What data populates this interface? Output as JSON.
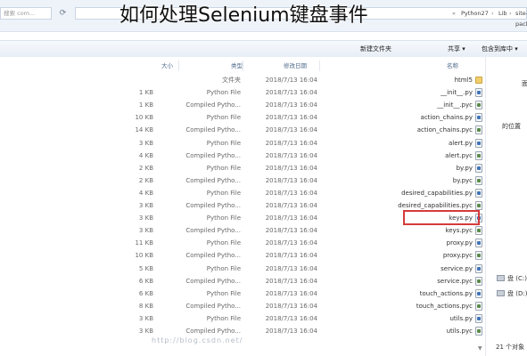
{
  "title": "如何处理Selenium键盘事件",
  "search": {
    "placeholder": "搜索 com..."
  },
  "breadcrumb": [
    "Python27",
    "Lib",
    "site-packa"
  ],
  "toolbar": {
    "organize": "组织 ▾",
    "include_in_library": "包含到库中 ▾",
    "share": "共享 ▾",
    "new_folder": "新建文件夹"
  },
  "columns": {
    "name": "名称",
    "modified": "修改日期",
    "type": "类型",
    "size": "大小"
  },
  "files": [
    {
      "name": "html5",
      "modified": "2018/7/13 16:04",
      "type": "文件夹",
      "size": "",
      "icon": "folder-icon"
    },
    {
      "name": "__init__.py",
      "modified": "2018/7/13 16:04",
      "type": "Python File",
      "size": "1 KB",
      "icon": "python-file-icon"
    },
    {
      "name": "__init__.pyc",
      "modified": "2018/7/13 16:04",
      "type": "Compiled Pytho...",
      "size": "1 KB",
      "icon": "compiled-python-icon"
    },
    {
      "name": "action_chains.py",
      "modified": "2018/7/13 16:04",
      "type": "Python File",
      "size": "10 KB",
      "icon": "python-file-icon"
    },
    {
      "name": "action_chains.pyc",
      "modified": "2018/7/13 16:04",
      "type": "Compiled Pytho...",
      "size": "14 KB",
      "icon": "compiled-python-icon"
    },
    {
      "name": "alert.py",
      "modified": "2018/7/13 16:04",
      "type": "Python File",
      "size": "3 KB",
      "icon": "python-file-icon"
    },
    {
      "name": "alert.pyc",
      "modified": "2018/7/13 16:04",
      "type": "Compiled Pytho...",
      "size": "4 KB",
      "icon": "compiled-python-icon"
    },
    {
      "name": "by.py",
      "modified": "2018/7/13 16:04",
      "type": "Python File",
      "size": "2 KB",
      "icon": "python-file-icon"
    },
    {
      "name": "by.pyc",
      "modified": "2018/7/13 16:04",
      "type": "Compiled Pytho...",
      "size": "2 KB",
      "icon": "compiled-python-icon"
    },
    {
      "name": "desired_capabilities.py",
      "modified": "2018/7/13 16:04",
      "type": "Python File",
      "size": "4 KB",
      "icon": "python-file-icon"
    },
    {
      "name": "desired_capabilities.pyc",
      "modified": "2018/7/13 16:04",
      "type": "Compiled Pytho...",
      "size": "3 KB",
      "icon": "compiled-python-icon"
    },
    {
      "name": "keys.py",
      "modified": "2018/7/13 16:04",
      "type": "Python File",
      "size": "3 KB",
      "icon": "python-file-icon"
    },
    {
      "name": "keys.pyc",
      "modified": "2018/7/13 16:04",
      "type": "Compiled Pytho...",
      "size": "3 KB",
      "icon": "compiled-python-icon"
    },
    {
      "name": "proxy.py",
      "modified": "2018/7/13 16:04",
      "type": "Python File",
      "size": "11 KB",
      "icon": "python-file-icon"
    },
    {
      "name": "proxy.pyc",
      "modified": "2018/7/13 16:04",
      "type": "Compiled Pytho...",
      "size": "10 KB",
      "icon": "compiled-python-icon"
    },
    {
      "name": "service.py",
      "modified": "2018/7/13 16:04",
      "type": "Python File",
      "size": "5 KB",
      "icon": "python-file-icon"
    },
    {
      "name": "service.pyc",
      "modified": "2018/7/13 16:04",
      "type": "Compiled Pytho...",
      "size": "6 KB",
      "icon": "compiled-python-icon"
    },
    {
      "name": "touch_actions.py",
      "modified": "2018/7/13 16:04",
      "type": "Python File",
      "size": "6 KB",
      "icon": "python-file-icon"
    },
    {
      "name": "touch_actions.pyc",
      "modified": "2018/7/13 16:04",
      "type": "Compiled Pytho...",
      "size": "8 KB",
      "icon": "compiled-python-icon"
    },
    {
      "name": "utils.py",
      "modified": "2018/7/13 16:04",
      "type": "Python File",
      "size": "3 KB",
      "icon": "python-file-icon"
    },
    {
      "name": "utils.pyc",
      "modified": "2018/7/13 16:04",
      "type": "Compiled Pytho...",
      "size": "3 KB",
      "icon": "compiled-python-icon"
    }
  ],
  "nav": {
    "item_top": "面",
    "item_recent": "的位置",
    "drive_c": "盘 (C:)",
    "drive_d": "盘 (D:)"
  },
  "status": {
    "item_count": "21 个对象"
  },
  "watermark": "http://blog.csdn.net/ "
}
